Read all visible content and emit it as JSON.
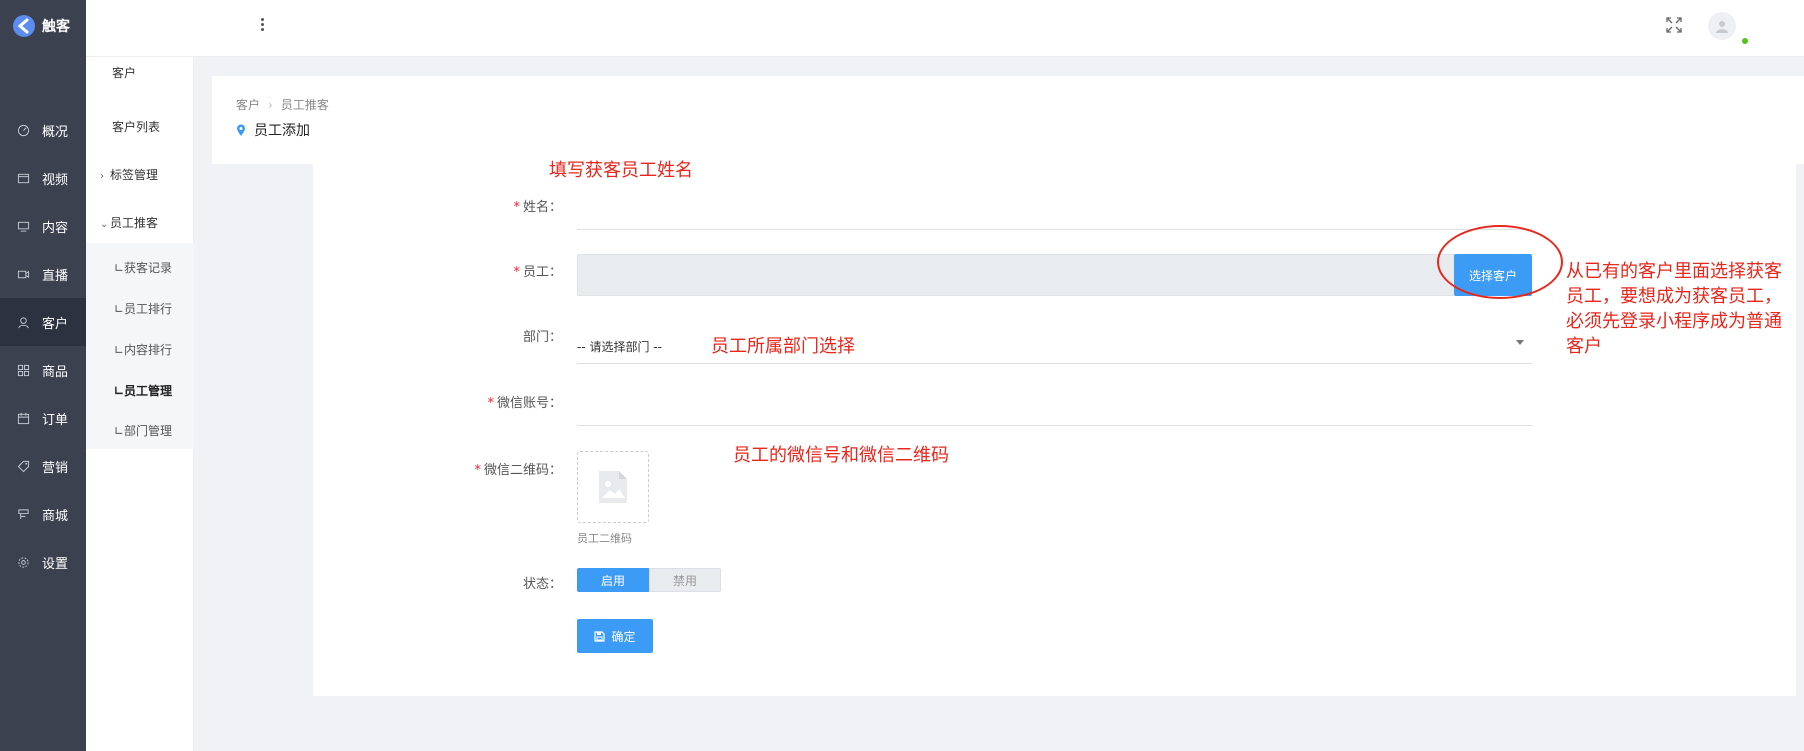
{
  "brand": {
    "name": "触客"
  },
  "nav": [
    {
      "label": "概况",
      "icon": "dashboard-icon"
    },
    {
      "label": "视频",
      "icon": "video-icon"
    },
    {
      "label": "内容",
      "icon": "content-icon"
    },
    {
      "label": "直播",
      "icon": "live-icon"
    },
    {
      "label": "客户",
      "icon": "customer-icon",
      "active": true
    },
    {
      "label": "商品",
      "icon": "goods-icon"
    },
    {
      "label": "订单",
      "icon": "order-icon"
    },
    {
      "label": "营销",
      "icon": "tag-icon"
    },
    {
      "label": "商城",
      "icon": "shop-icon"
    },
    {
      "label": "设置",
      "icon": "gear-icon"
    }
  ],
  "submenu": {
    "group_title": "客户",
    "customer_list": "客户列表",
    "tag_mgmt": "标签管理",
    "referral": "员工推客",
    "children": [
      "∟获客记录",
      "∟员工排行",
      "∟内容排行",
      "∟员工管理",
      "∟部门管理"
    ]
  },
  "breadcrumb": {
    "parent": "客户",
    "current": "员工推客"
  },
  "page_title": "员工添加",
  "form": {
    "name_label": "姓名：",
    "employee_label": "员工：",
    "select_customer_btn": "选择客户",
    "dept_label": "部门：",
    "dept_placeholder": "-- 请选择部门 --",
    "wechat_label": "微信账号：",
    "qrcode_label": "微信二维码：",
    "qrcode_caption": "员工二维码",
    "status_label": "状态：",
    "status_on": "启用",
    "status_off": "禁用",
    "submit": "确定"
  },
  "annotations": {
    "name_hint": "填写获客员工姓名",
    "employee_hint": "从已有的客户里面选择获客员工，要想成为获客员工，必须先登录小程序成为普通客户",
    "dept_hint": "员工所属部门选择",
    "wechat_hint": "员工的微信号和微信二维码"
  },
  "colors": {
    "sidebar": "#3c4150",
    "primary": "#3c9cf5",
    "annotation": "#e8261c"
  }
}
